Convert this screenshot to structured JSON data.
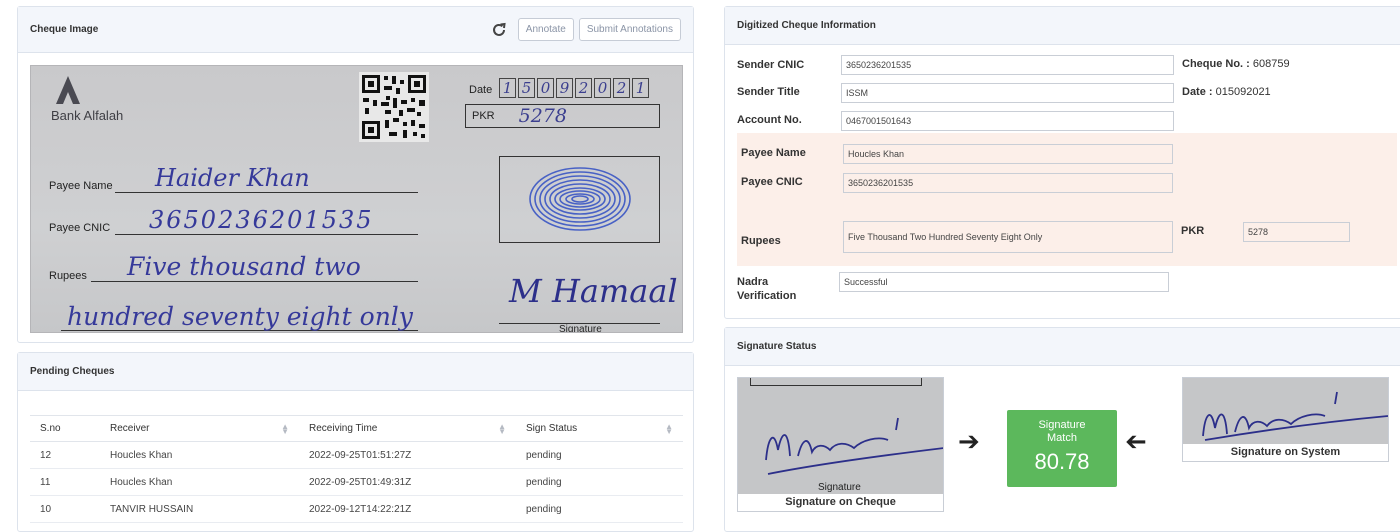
{
  "cheque_panel": {
    "title": "Cheque Image",
    "annotate_label": "Annotate",
    "submit_label": "Submit Annotations",
    "cheque": {
      "bank_name": "Bank Alfalah",
      "date_label": "Date",
      "date_digits": [
        "1",
        "5",
        "0",
        "9",
        "2",
        "0",
        "2",
        "1"
      ],
      "pkr_label": "PKR",
      "pkr_value": "5278",
      "payee_name_label": "Payee Name",
      "payee_name_hand": "Haider Khan",
      "payee_cnic_label": "Payee CNIC",
      "payee_cnic_hand": "3650236201535",
      "rupees_label": "Rupees",
      "rupees_hand_1": "Five thousand two",
      "rupees_hand_2": "hundred seventy eight only",
      "signature_hand": "M Hamaal",
      "signature_label": "Signature"
    }
  },
  "pending_panel": {
    "title": "Pending Cheques",
    "columns": [
      "S.no",
      "Receiver",
      "Receiving Time",
      "Sign Status"
    ],
    "rows": [
      [
        "12",
        "Houcles Khan",
        "2022-09-25T01:51:27Z",
        "pending"
      ],
      [
        "11",
        "Houcles Khan",
        "2022-09-25T01:49:31Z",
        "pending"
      ],
      [
        "10",
        "TANVIR HUSSAIN",
        "2022-09-12T14:22:21Z",
        "pending"
      ]
    ]
  },
  "digitized_panel": {
    "title": "Digitized Cheque Information",
    "sender_cnic_label": "Sender CNIC",
    "sender_cnic_value": "3650236201535",
    "sender_title_label": "Sender Title",
    "sender_title_value": "ISSM",
    "account_no_label": "Account No.",
    "account_no_value": "0467001501643",
    "cheque_no_label": "Cheque No. :",
    "cheque_no_value": " 608759",
    "date_label": "Date :",
    "date_value": " 015092021",
    "payee_name_label": "Payee Name",
    "payee_name_value": "Houcles Khan",
    "payee_cnic_label": "Payee CNIC",
    "payee_cnic_value": "3650236201535",
    "rupees_label": "Rupees",
    "rupees_value": "Five Thousand Two Hundred Seventy Eight Only",
    "pkr_label": "PKR",
    "pkr_value": "5278",
    "nadra_label_1": "Nadra",
    "nadra_label_2": "Verification",
    "nadra_value": "Successful"
  },
  "signature_panel": {
    "title": "Signature Status",
    "cheque_sig_caption": "Signature on Cheque",
    "cheque_sig_inner_label": "Signature",
    "system_sig_caption": "Signature on System",
    "match_title_1": "Signature",
    "match_title_2": "Match",
    "match_value": "80.78",
    "match_color": "#5cb85c"
  }
}
